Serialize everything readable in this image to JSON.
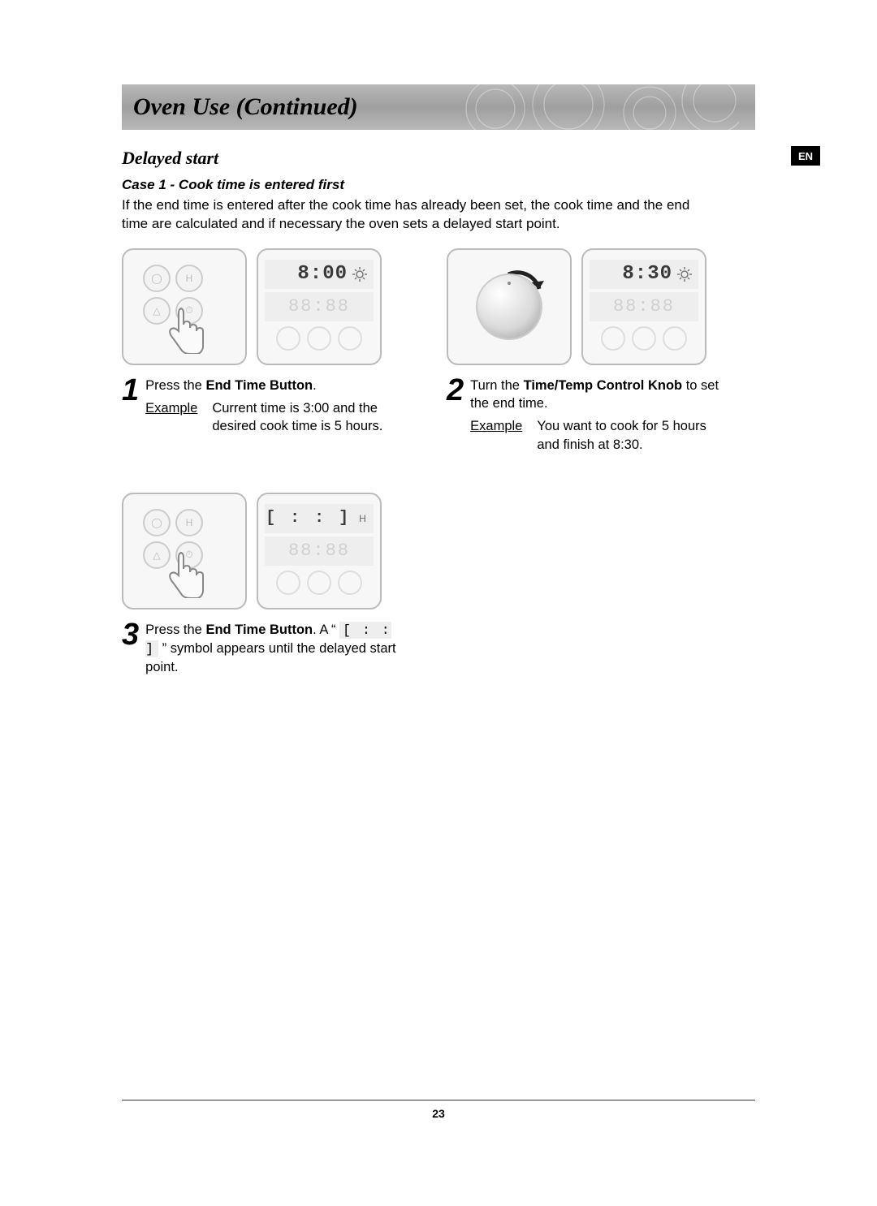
{
  "banner": {
    "title": "Oven Use (Continued)"
  },
  "lang_badge": "EN",
  "section": {
    "heading": "Delayed start",
    "case_title": "Case 1 - Cook time is entered first",
    "intro": "If the end time is entered after the cook time has already been set, the cook time and the end time are calculated and if necessary the oven sets a delayed start point."
  },
  "steps": [
    {
      "num": "1",
      "display_value": "8:00",
      "text_before": "Press the ",
      "text_bold": "End Time Button",
      "text_after": ".",
      "example_label": "Example",
      "example_text": "Current time is 3:00 and the desired cook time is 5 hours."
    },
    {
      "num": "2",
      "display_value": "8:30",
      "text_before": "Turn the ",
      "text_bold": "Time/Temp Control Knob",
      "text_after": " to set the end time.",
      "example_label": "Example",
      "example_text": "You want to cook for 5 hours and finish at 8:30."
    },
    {
      "num": "3",
      "display_value": "[ : : ]",
      "text_before": "Press the ",
      "text_bold": "End Time Button",
      "text_after_a": ". A “ ",
      "symbol": "[ : : ]",
      "text_after_b": " ” symbol appears until the delayed start point."
    }
  ],
  "display_dim": "88:88",
  "page_number": "23"
}
